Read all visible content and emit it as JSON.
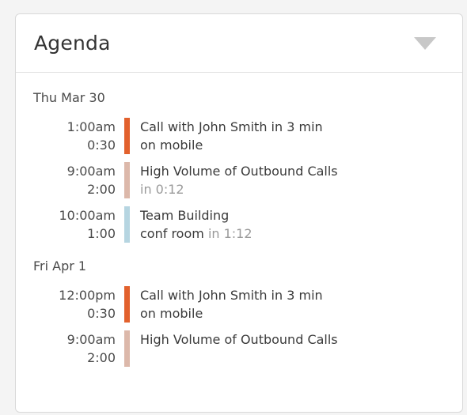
{
  "header": {
    "title": "Agenda"
  },
  "colors": {
    "urgent": "#e2612d",
    "neutral": "#dcb8aa",
    "info": "#b6d5e1"
  },
  "days": [
    {
      "label": "Thu Mar 30",
      "events": [
        {
          "start": "1:00am",
          "duration": "0:30",
          "title": "Call with John Smith in 3 min",
          "detail": "on mobile",
          "countdown": "",
          "color": "urgent"
        },
        {
          "start": "9:00am",
          "duration": "2:00",
          "title": "High Volume of Outbound Calls",
          "detail": "",
          "countdown": "in 0:12",
          "color": "neutral"
        },
        {
          "start": "10:00am",
          "duration": "1:00",
          "title": "Team Building",
          "detail": "conf room",
          "countdown": "in 1:12",
          "color": "info"
        }
      ]
    },
    {
      "label": "Fri Apr 1",
      "events": [
        {
          "start": "12:00pm",
          "duration": "0:30",
          "title": "Call with John Smith in 3 min",
          "detail": "on mobile",
          "countdown": "",
          "color": "urgent"
        },
        {
          "start": "9:00am",
          "duration": "2:00",
          "title": "High Volume of Outbound Calls",
          "detail": "",
          "countdown": "",
          "color": "neutral"
        }
      ]
    }
  ]
}
